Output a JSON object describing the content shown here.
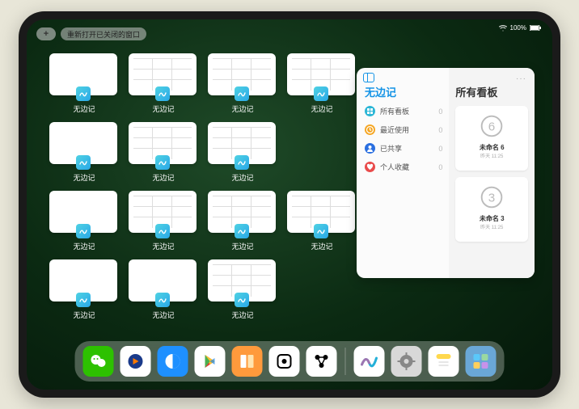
{
  "status": {
    "battery": "100%"
  },
  "top": {
    "plus": "+",
    "pill": "重新打开已关闭的窗口"
  },
  "thumb_label": "无边记",
  "grid_types": [
    "blank",
    "cal",
    "cal",
    "cal",
    "blank",
    "cal",
    "cal",
    null,
    "blank",
    "cal",
    "cal",
    "cal",
    "blank",
    "blank",
    "cal",
    null
  ],
  "panel": {
    "left_title": "无边记",
    "right_title": "所有看板",
    "menu_dots": "···",
    "rows": [
      {
        "label": "所有看板",
        "count": 0,
        "color": "#2bb6d6",
        "icon": "grid"
      },
      {
        "label": "最近使用",
        "count": 0,
        "color": "#f5a623",
        "icon": "clock"
      },
      {
        "label": "已共享",
        "count": 0,
        "color": "#2a6fe0",
        "icon": "person"
      },
      {
        "label": "个人收藏",
        "count": 0,
        "color": "#e94b4b",
        "icon": "heart"
      }
    ],
    "boards": [
      {
        "title": "未命名 6",
        "time": "昨天 11:25",
        "digit": "6"
      },
      {
        "title": "未命名 3",
        "time": "昨天 11:25",
        "digit": "3"
      }
    ]
  },
  "dock": [
    {
      "name": "wechat",
      "bg": "#2dc100"
    },
    {
      "name": "tencent-video",
      "bg": "#ffffff"
    },
    {
      "name": "qq-browser",
      "bg": "#1e90ff"
    },
    {
      "name": "play",
      "bg": "#ffffff"
    },
    {
      "name": "books",
      "bg": "#ff9a3c"
    },
    {
      "name": "dice",
      "bg": "#ffffff"
    },
    {
      "name": "nodes",
      "bg": "#ffffff"
    },
    {
      "name": "freeform",
      "bg": "#ffffff"
    },
    {
      "name": "settings",
      "bg": "#d8d8d8"
    },
    {
      "name": "notes",
      "bg": "#ffffff"
    },
    {
      "name": "app-library",
      "bg": "#6aa7d6"
    }
  ]
}
